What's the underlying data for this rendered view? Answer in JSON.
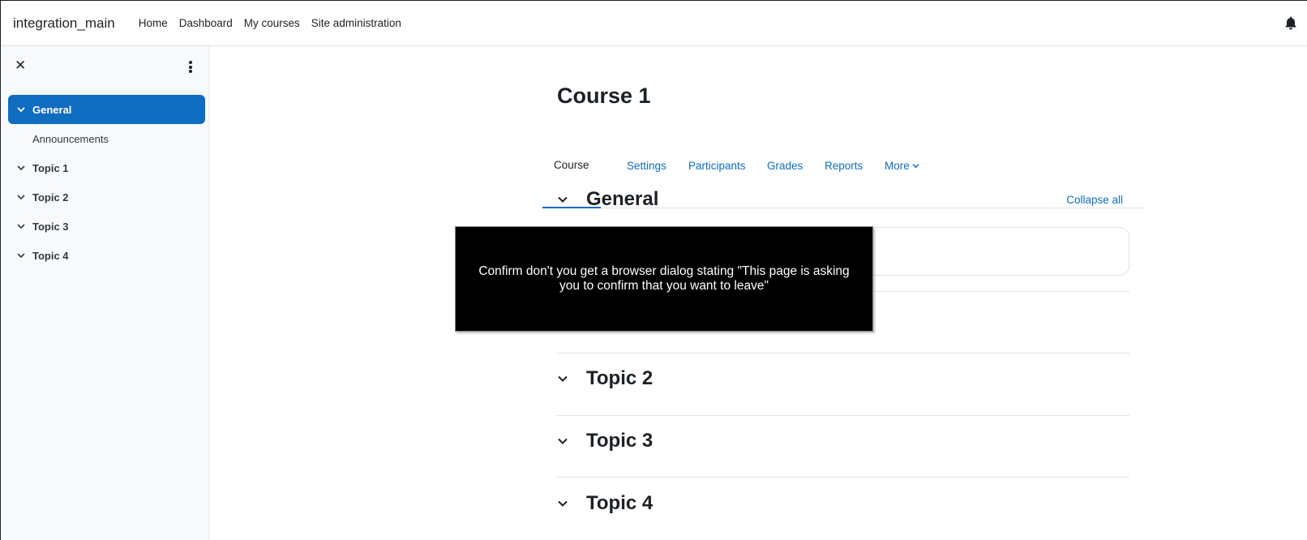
{
  "navbar": {
    "brand": "integration_main",
    "links": [
      "Home",
      "Dashboard",
      "My courses",
      "Site administration"
    ],
    "notification_icon": "bell-icon"
  },
  "drawer": {
    "close_icon": "close-icon",
    "menu_icon": "kebab-menu-icon",
    "items": [
      {
        "label": "General",
        "active": true
      },
      {
        "label": "Announcements",
        "sub": true
      },
      {
        "label": "Topic 1"
      },
      {
        "label": "Topic 2"
      },
      {
        "label": "Topic 3"
      },
      {
        "label": "Topic 4"
      }
    ]
  },
  "course": {
    "title": "Course 1",
    "tabs": [
      "Course",
      "Settings",
      "Participants",
      "Grades",
      "Reports",
      "More"
    ],
    "collapse_all": "Collapse all",
    "sections": [
      "General",
      "Topic 2",
      "Topic 3",
      "Topic 4"
    ]
  },
  "tooltip": {
    "text": "Confirm don't you get a browser dialog stating \"This page is asking you to confirm that you want to leave\""
  },
  "colors": {
    "accent": "#0f6cbf",
    "text": "#1d2125",
    "drawer_bg": "#f8f9fa"
  }
}
